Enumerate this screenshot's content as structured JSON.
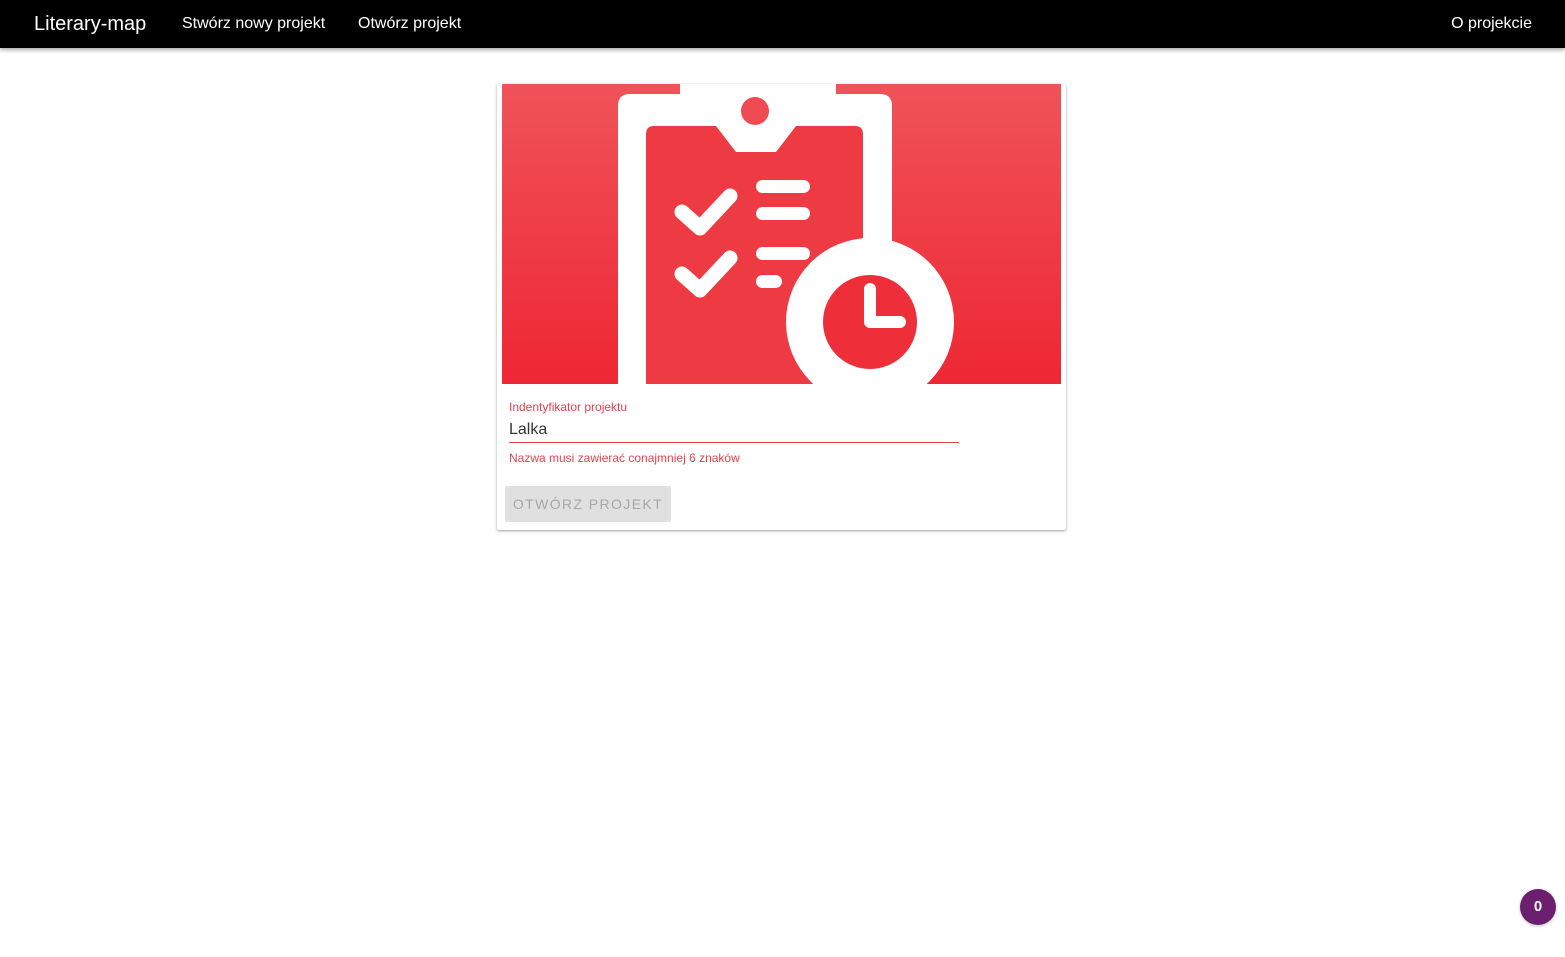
{
  "navbar": {
    "brand": "Literary-map",
    "links": [
      {
        "label": "Stwórz nowy projekt"
      },
      {
        "label": "Otwórz projekt"
      }
    ],
    "about_label": "O projekcie",
    "background": "#000000"
  },
  "card": {
    "image": {
      "icon": "clipboard-checklist-clock-icon",
      "gradient_top": "#ef5359",
      "gradient_bottom": "#ee2733"
    },
    "field": {
      "label": "Indentyfikator projektu",
      "value": "Lalka",
      "error": "Nazwa musi zawierać conajmniej 6 znaków",
      "accent_color": "#e0434f"
    },
    "button": {
      "label": "Otwórz projekt",
      "disabled": true
    }
  },
  "badge": {
    "count": "0",
    "color": "#6c1f6e"
  }
}
